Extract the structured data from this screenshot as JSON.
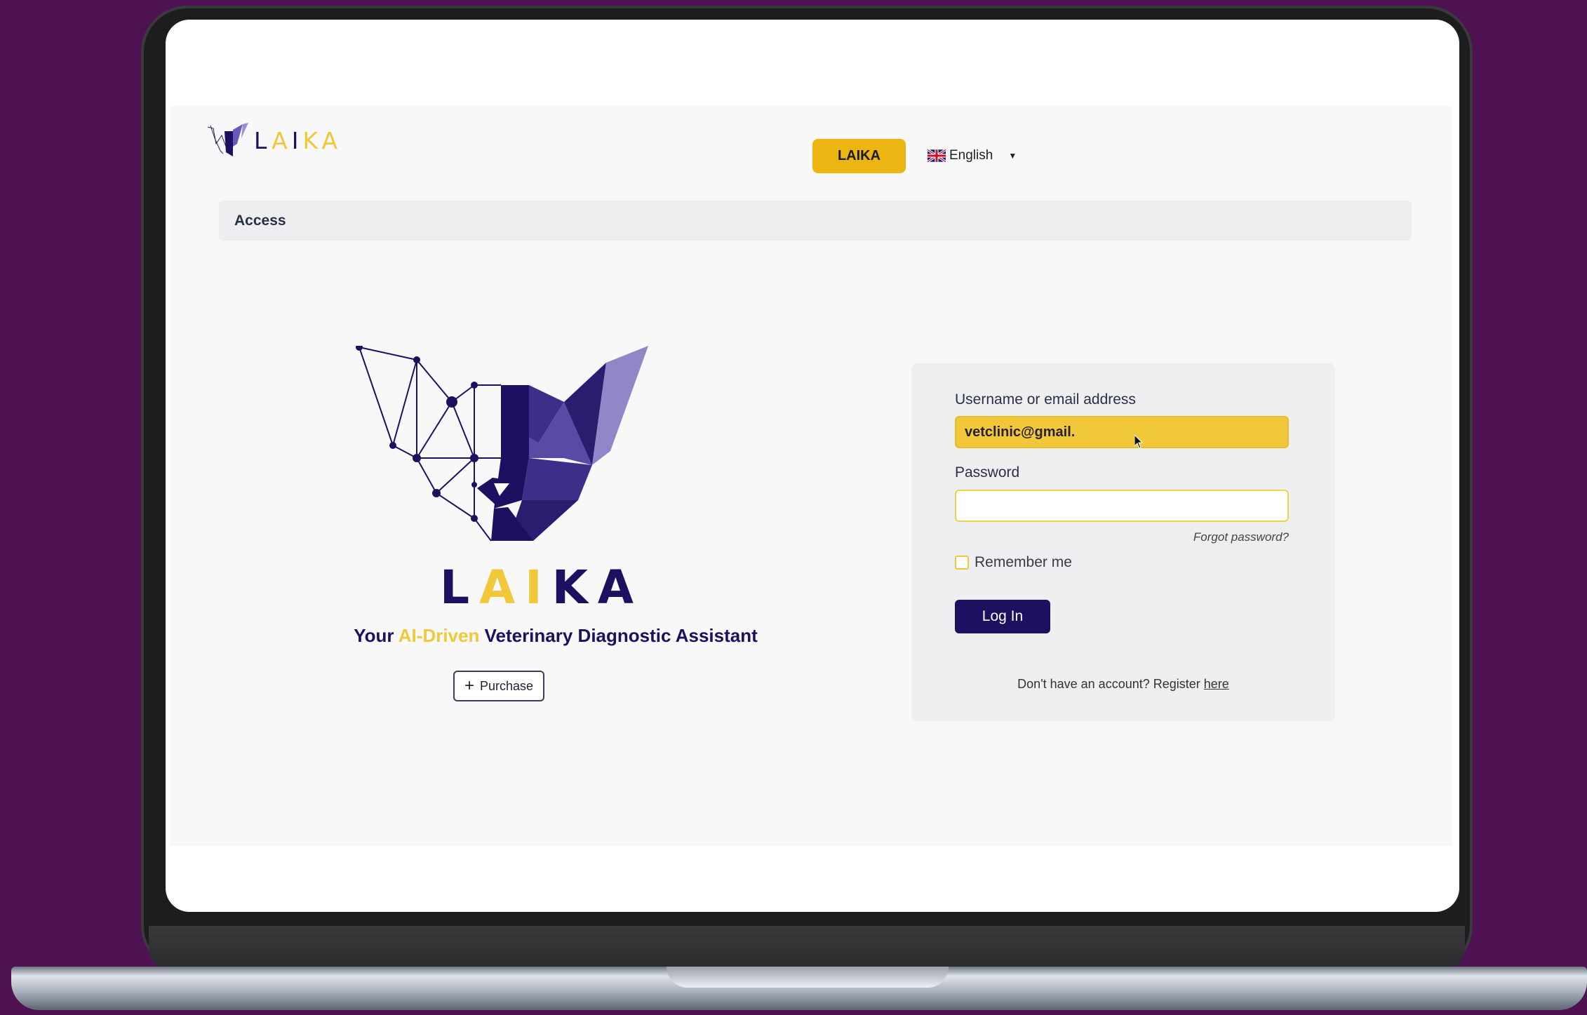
{
  "header": {
    "logo_text": "LAIKA",
    "nav_button_label": "LAIKA",
    "language": "English"
  },
  "breadcrumb": {
    "label": "Access"
  },
  "hero": {
    "title": "LAIKA",
    "tagline_prefix": "Your ",
    "tagline_highlight": "AI-Driven",
    "tagline_suffix": " Veterinary Diagnostic Assistant",
    "purchase_label": "Purchase"
  },
  "login": {
    "username_label": "Username or email address",
    "username_value": "vetclinic@gmail.",
    "password_label": "Password",
    "password_value": "",
    "forgot_label": "Forgot password?",
    "remember_label": "Remember me",
    "remember_checked": false,
    "submit_label": "Log In",
    "register_text": "Don't have an account? Register ",
    "register_link": "here"
  },
  "colors": {
    "brand_purple": "#1d1060",
    "brand_yellow": "#f0c83a",
    "background": "#4e1152"
  },
  "icons": {
    "language_flag": "uk-flag-icon",
    "dropdown": "caret-down-icon",
    "add": "plus-icon",
    "cursor": "mouse-pointer-icon"
  }
}
